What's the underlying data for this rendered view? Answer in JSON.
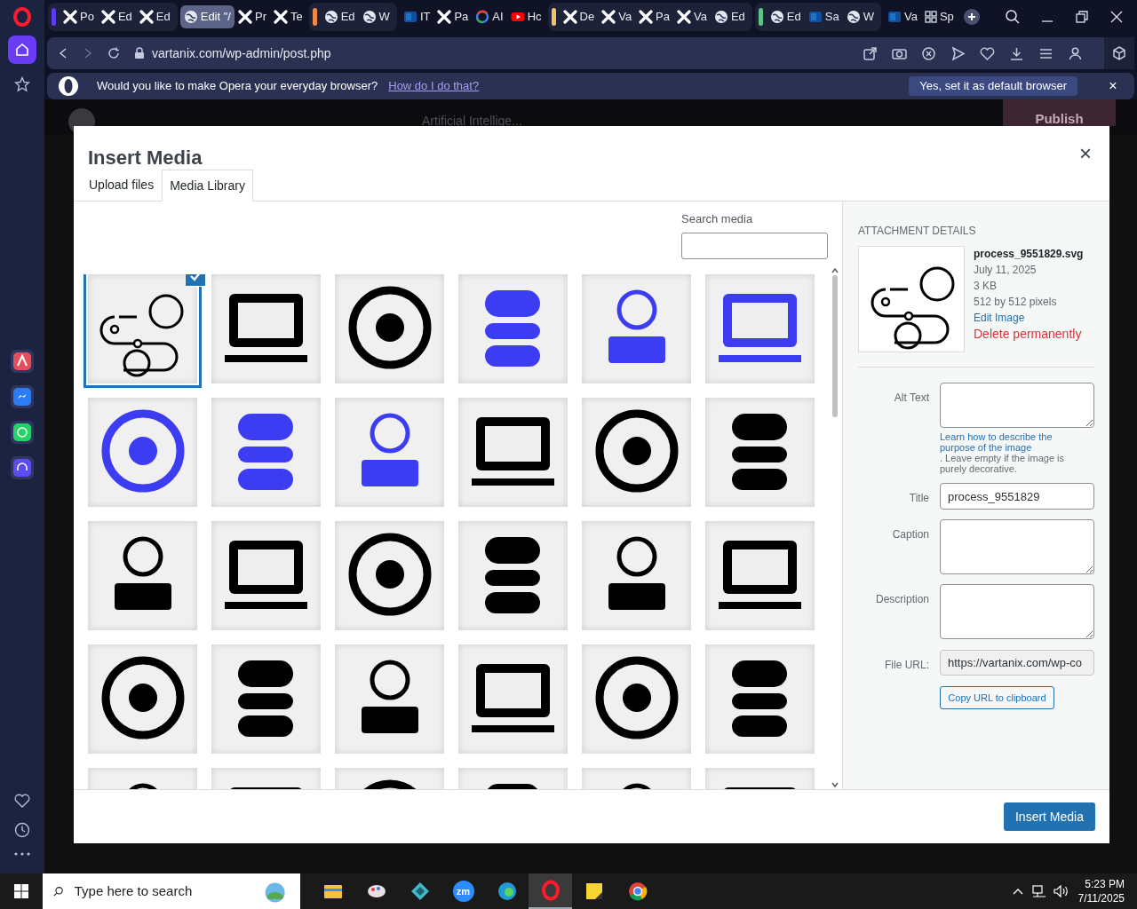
{
  "browser": {
    "tab_groups": [
      {
        "color": "#5b3cf0",
        "tabs": [
          {
            "label": "Po",
            "kind": "x",
            "selected": false
          },
          {
            "label": "Ed",
            "kind": "x",
            "selected": false
          },
          {
            "label": "Ed",
            "kind": "x",
            "selected": false
          }
        ]
      },
      {
        "tabs": [
          {
            "label": "Edit \"/",
            "kind": "globe",
            "selected": true
          },
          {
            "label": "Pr",
            "kind": "x",
            "selected": false
          },
          {
            "label": "Te",
            "kind": "x",
            "selected": false
          }
        ]
      },
      {
        "color": "#f08a4b",
        "tabs": [
          {
            "label": "Ed",
            "kind": "globe",
            "selected": false
          },
          {
            "label": "W",
            "kind": "globe",
            "selected": false
          }
        ]
      },
      {
        "tabs": [
          {
            "label": "IT",
            "kind": "outlook",
            "selected": false
          },
          {
            "label": "Pa",
            "kind": "x",
            "selected": false
          },
          {
            "label": "AI",
            "kind": "google",
            "selected": false
          },
          {
            "label": "Hc",
            "kind": "youtube",
            "selected": false
          }
        ]
      },
      {
        "color": "#f0c36b",
        "tabs": [
          {
            "label": "De",
            "kind": "x",
            "selected": false
          },
          {
            "label": "Va",
            "kind": "x",
            "selected": false
          },
          {
            "label": "Pa",
            "kind": "x",
            "selected": false
          },
          {
            "label": "Va",
            "kind": "x",
            "selected": false
          },
          {
            "label": "Ed",
            "kind": "globe",
            "selected": false
          }
        ]
      },
      {
        "color": "#5fc48a",
        "tabs": [
          {
            "label": "Ed",
            "kind": "globe",
            "selected": false
          },
          {
            "label": "Sa",
            "kind": "outlook",
            "selected": false
          },
          {
            "label": "W",
            "kind": "globe",
            "selected": false
          }
        ]
      },
      {
        "tabs": [
          {
            "label": "Va",
            "kind": "outlook",
            "selected": false
          },
          {
            "label": "Sp",
            "kind": "grid",
            "selected": false
          }
        ]
      }
    ],
    "address": "vartanix.com/wp-admin/post.php",
    "infobar": {
      "message": "Would you like to make Opera your everyday browser?",
      "link": "How do I do that?",
      "button": "Yes, set it as default browser",
      "close": "×"
    }
  },
  "editor_toolbar": {
    "document_title": "Artificial Intellige...",
    "publish": "Publish"
  },
  "modal": {
    "title": "Insert Media",
    "close": "×",
    "tabs": [
      {
        "label": "Upload files",
        "selected": false
      },
      {
        "label": "Media Library",
        "selected": true
      }
    ],
    "search_label": "Search media",
    "attachments": [
      {
        "kind": "outline",
        "selected": true
      },
      {
        "kind": "solid",
        "selected": false
      },
      {
        "kind": "solid",
        "selected": false
      },
      {
        "kind": "blue",
        "selected": false
      },
      {
        "kind": "blue",
        "selected": false
      },
      {
        "kind": "blue",
        "selected": false
      },
      {
        "kind": "blue",
        "selected": false
      },
      {
        "kind": "blue",
        "selected": false
      },
      {
        "kind": "blue",
        "selected": false
      },
      {
        "kind": "solid",
        "selected": false
      },
      {
        "kind": "solid",
        "selected": false
      },
      {
        "kind": "solid",
        "selected": false
      },
      {
        "kind": "solid",
        "selected": false
      },
      {
        "kind": "solid",
        "selected": false
      },
      {
        "kind": "solid",
        "selected": false
      },
      {
        "kind": "solid",
        "selected": false
      },
      {
        "kind": "solid",
        "selected": false
      },
      {
        "kind": "solid",
        "selected": false
      },
      {
        "kind": "solid",
        "selected": false
      },
      {
        "kind": "solid",
        "selected": false
      },
      {
        "kind": "solid",
        "selected": false
      },
      {
        "kind": "solid",
        "selected": false
      },
      {
        "kind": "solid",
        "selected": false
      },
      {
        "kind": "solid",
        "selected": false
      },
      {
        "kind": "solid",
        "selected": false
      },
      {
        "kind": "solid",
        "selected": false
      },
      {
        "kind": "solid",
        "selected": false
      },
      {
        "kind": "solid",
        "selected": false
      },
      {
        "kind": "solid",
        "selected": false
      },
      {
        "kind": "solid",
        "selected": false
      }
    ],
    "details": {
      "heading": "ATTACHMENT DETAILS",
      "filename": "process_9551829.svg",
      "date": "July 11, 2025",
      "size": "3 KB",
      "dimensions": "512 by 512 pixels",
      "edit_link": "Edit Image",
      "delete_link": "Delete permanently",
      "alt_label": "Alt Text",
      "help_link": "Learn how to describe the purpose of the image",
      "help_text": ". Leave empty if the image is purely decorative.",
      "title_label": "Title",
      "title_value": "process_9551829",
      "caption_label": "Caption",
      "description_label": "Description",
      "url_label": "File URL:",
      "url_value": "https://vartanix.com/wp-co",
      "copy_button": "Copy URL to clipboard"
    },
    "insert_button": "Insert Media"
  },
  "taskbar": {
    "search_placeholder": "Type here to search",
    "apps": [
      {
        "kind": "folder",
        "selected": false
      },
      {
        "kind": "paint",
        "selected": false
      },
      {
        "kind": "diamond",
        "selected": false
      },
      {
        "kind": "zoom",
        "label": "zm",
        "selected": false
      },
      {
        "kind": "edge",
        "selected": false
      },
      {
        "kind": "opera",
        "selected": true
      },
      {
        "kind": "notes",
        "selected": false
      },
      {
        "kind": "chrome",
        "selected": false
      }
    ],
    "time": "5:23 PM",
    "date": "7/11/2025"
  }
}
